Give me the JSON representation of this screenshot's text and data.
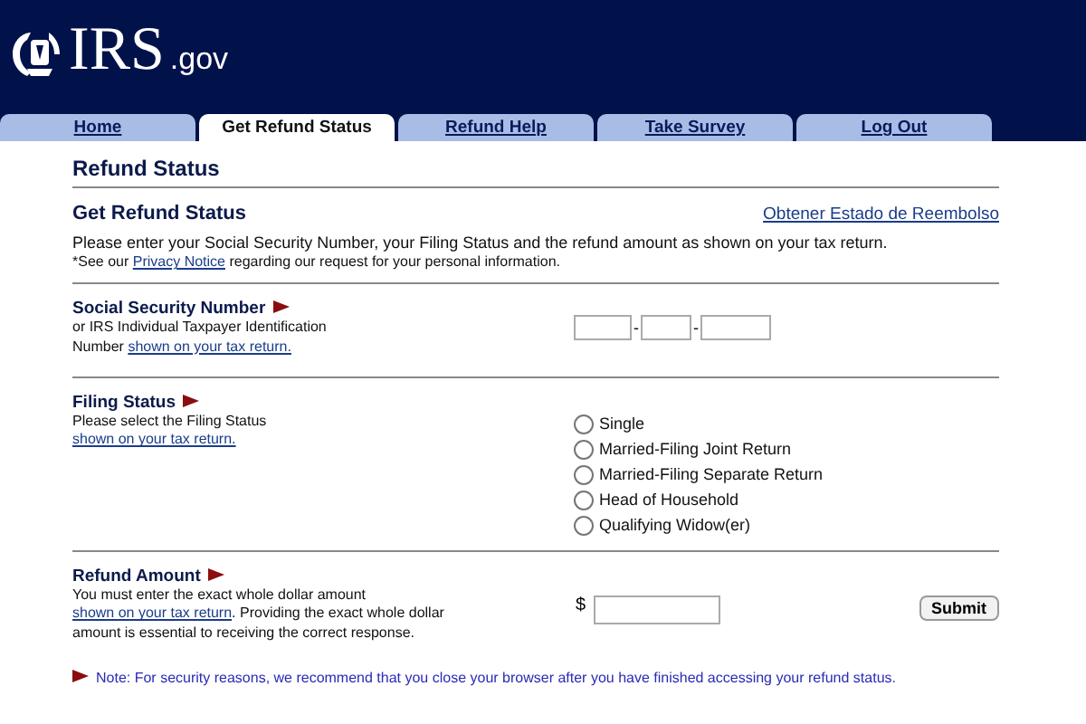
{
  "header": {
    "logo": "IRS",
    "logo_suffix": ".gov"
  },
  "tabs": [
    {
      "label": "Home",
      "selected": false
    },
    {
      "label": "Get Refund Status",
      "selected": true
    },
    {
      "label": "Refund Help",
      "selected": false
    },
    {
      "label": "Take Survey",
      "selected": false
    },
    {
      "label": "Log Out",
      "selected": false
    }
  ],
  "page_title": "Refund Status",
  "intro": {
    "title": "Get Refund Status",
    "language_link": "Obtener Estado de Reembolso",
    "text": "Please enter your Social Security Number, your Filing Status and the refund amount as shown on your tax return.",
    "privacy_before": "*See our",
    "privacy_link": "Privacy Notice",
    "privacy_after": "regarding our request for your personal information."
  },
  "ssn": {
    "label": "Social Security Number",
    "text": "or IRS Individual Taxpayer Identification Number",
    "link": "shown on your tax return.",
    "separators": [
      "-",
      "-"
    ]
  },
  "filing_status": {
    "label": "Filing Status",
    "text": "Please select the Filing Status",
    "link": "shown on your tax return.",
    "options": [
      {
        "label": "Single",
        "selected": false
      },
      {
        "label": "Married-Filing Joint Return",
        "selected": false
      },
      {
        "label": "Married-Filing Separate Return",
        "selected": false
      },
      {
        "label": "Head of Household",
        "selected": false
      },
      {
        "label": "Qualifying Widow(er)",
        "selected": false
      }
    ]
  },
  "refund_amount": {
    "label": "Refund Amount",
    "text_before": "You must enter the exact whole dollar amount",
    "link": "shown on your tax return",
    "text_after": ". Providing the exact whole dollar amount is essential to receiving the correct response.",
    "currency": "$",
    "submit": "Submit"
  },
  "note": "Note: For security reasons, we recommend that you close your browser after you have finished accessing your refund status."
}
